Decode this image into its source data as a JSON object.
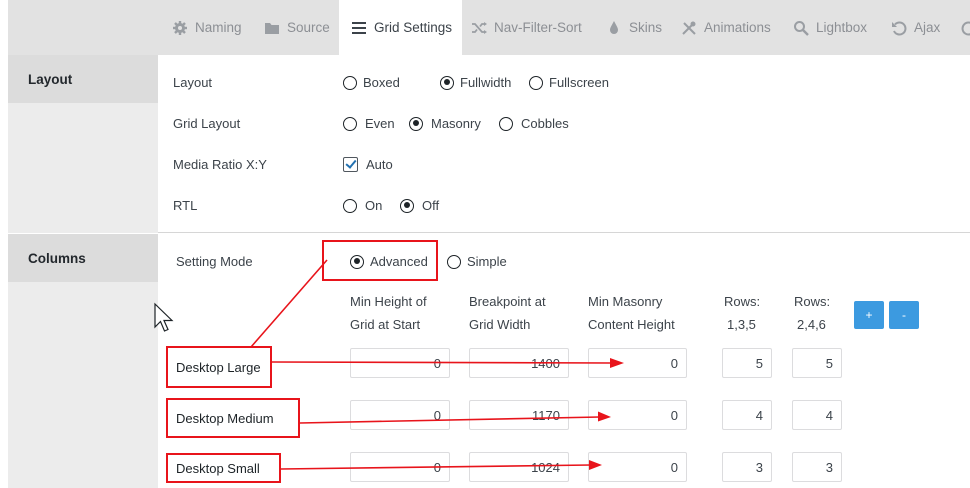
{
  "tabs": [
    {
      "label": "Naming",
      "icon": "gear-icon"
    },
    {
      "label": "Source",
      "icon": "folder-icon"
    },
    {
      "label": "Grid Settings",
      "icon": "list-icon",
      "active": true
    },
    {
      "label": "Nav-Filter-Sort",
      "icon": "shuffle-icon"
    },
    {
      "label": "Skins",
      "icon": "drop-icon"
    },
    {
      "label": "Animations",
      "icon": "tools-icon"
    },
    {
      "label": "Lightbox",
      "icon": "search-icon"
    },
    {
      "label": "Ajax",
      "icon": "undo-icon"
    }
  ],
  "sections": {
    "layout": "Layout",
    "columns": "Columns"
  },
  "layout_rows": {
    "layout": {
      "label": "Layout",
      "options": [
        "Boxed",
        "Fullwidth",
        "Fullscreen"
      ],
      "selected": "Fullwidth"
    },
    "grid_layout": {
      "label": "Grid Layout",
      "options": [
        "Even",
        "Masonry",
        "Cobbles"
      ],
      "selected": "Masonry"
    },
    "media_ratio": {
      "label": "Media Ratio X:Y",
      "checkbox_label": "Auto",
      "checked": true
    },
    "rtl": {
      "label": "RTL",
      "options": [
        "On",
        "Off"
      ],
      "selected": "Off"
    }
  },
  "columns": {
    "setting_mode": {
      "label": "Setting Mode",
      "options": [
        "Advanced",
        "Simple"
      ],
      "selected": "Advanced"
    },
    "headers": {
      "min_height_1": "Min Height of",
      "min_height_2": "Grid at Start",
      "breakpoint_1": "Breakpoint at",
      "breakpoint_2": "Grid Width",
      "masonry_1": "Min Masonry",
      "masonry_2": "Content Height",
      "rows_a_1": "Rows:",
      "rows_a_2": "1,3,5",
      "rows_b_1": "Rows:",
      "rows_b_2": "2,4,6"
    },
    "add_button": "+",
    "remove_button": "-",
    "breakpoints": [
      {
        "name": "Desktop Large",
        "min_height": "0",
        "breakpoint": "1400",
        "masonry": "0",
        "rows_a": "5",
        "rows_b": "5"
      },
      {
        "name": "Desktop Medium",
        "min_height": "0",
        "breakpoint": "1170",
        "masonry": "0",
        "rows_a": "4",
        "rows_b": "4"
      },
      {
        "name": "Desktop Small",
        "min_height": "0",
        "breakpoint": "1024",
        "masonry": "0",
        "rows_a": "3",
        "rows_b": "3"
      }
    ]
  },
  "colors": {
    "accent": "#3c9ae0",
    "annotation": "#e8141b"
  }
}
